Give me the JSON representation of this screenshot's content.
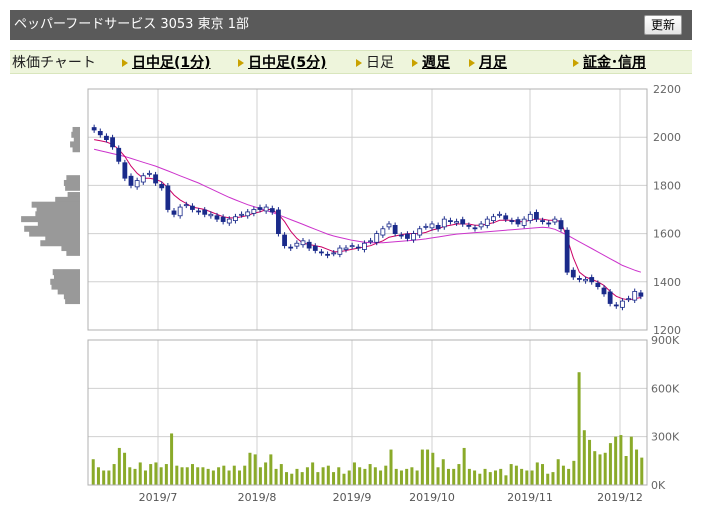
{
  "header": {
    "title": "ペッパーフードサービス 3053 東京 1部",
    "refresh_label": "更新"
  },
  "tabs": [
    {
      "label": "株価チャート",
      "style": "plain",
      "arrow": false
    },
    {
      "label": "日中足(1分)",
      "style": "link",
      "arrow": true
    },
    {
      "label": "日中足(5分)",
      "style": "link",
      "arrow": true
    },
    {
      "label": "日足",
      "style": "plain",
      "arrow": true
    },
    {
      "label": "週足",
      "style": "link",
      "arrow": true
    },
    {
      "label": "月足",
      "style": "link",
      "arrow": true
    },
    {
      "label": "証金･信用",
      "style": "link",
      "arrow": true
    }
  ],
  "colors": {
    "up_candle": "#ffffff",
    "down_candle": "#1a2a8a",
    "candle_outline": "#1a2a8a",
    "ma_short": "#cc0066",
    "ma_long": "#cc33cc",
    "volume": "#8aaa2a",
    "volume_profile": "#999999",
    "grid": "#d0d0d0"
  },
  "chart_data": [
    {
      "type": "candlestick",
      "ylim": [
        1200,
        2200
      ],
      "y_ticks": [
        "2200",
        "2000",
        "1800",
        "1600",
        "1400",
        "1200"
      ],
      "x_ticks": [
        "2019/7",
        "2019/8",
        "2019/9",
        "2019/10",
        "2019/11",
        "2019/12"
      ],
      "close": [
        2030,
        2010,
        1990,
        1960,
        1900,
        1830,
        1800,
        1820,
        1840,
        1850,
        1810,
        1790,
        1700,
        1680,
        1710,
        1720,
        1700,
        1690,
        1680,
        1680,
        1660,
        1650,
        1660,
        1670,
        1680,
        1690,
        1700,
        1700,
        1710,
        1690,
        1600,
        1550,
        1540,
        1560,
        1570,
        1540,
        1530,
        1520,
        1510,
        1520,
        1540,
        1540,
        1550,
        1540,
        1560,
        1570,
        1600,
        1620,
        1640,
        1600,
        1590,
        1580,
        1600,
        1620,
        1630,
        1640,
        1620,
        1660,
        1650,
        1650,
        1640,
        1630,
        1620,
        1640,
        1660,
        1670,
        1680,
        1660,
        1650,
        1640,
        1660,
        1680,
        1660,
        1650,
        1640,
        1660,
        1620,
        1440,
        1420,
        1410,
        1410,
        1400,
        1380,
        1350,
        1310,
        1300,
        1320,
        1330,
        1360,
        1340
      ],
      "ma_short": [
        1990,
        1985,
        1980,
        1970,
        1950,
        1920,
        1880,
        1850,
        1830,
        1830,
        1825,
        1815,
        1790,
        1760,
        1740,
        1725,
        1710,
        1705,
        1700,
        1690,
        1680,
        1670,
        1665,
        1665,
        1670,
        1675,
        1685,
        1690,
        1700,
        1700,
        1680,
        1650,
        1610,
        1580,
        1560,
        1555,
        1550,
        1545,
        1535,
        1525,
        1525,
        1530,
        1535,
        1540,
        1545,
        1550,
        1560,
        1570,
        1585,
        1590,
        1595,
        1600,
        1600,
        1600,
        1605,
        1615,
        1620,
        1630,
        1635,
        1640,
        1640,
        1640,
        1635,
        1635,
        1640,
        1645,
        1655,
        1655,
        1655,
        1650,
        1650,
        1655,
        1660,
        1660,
        1655,
        1655,
        1650,
        1580,
        1500,
        1440,
        1420,
        1410,
        1400,
        1385,
        1360,
        1340,
        1330,
        1325,
        1330,
        1335
      ],
      "ma_long": [
        1950,
        1944,
        1938,
        1932,
        1926,
        1920,
        1912,
        1904,
        1896,
        1888,
        1880,
        1870,
        1860,
        1850,
        1840,
        1830,
        1820,
        1810,
        1798,
        1786,
        1774,
        1762,
        1750,
        1740,
        1730,
        1720,
        1712,
        1704,
        1696,
        1688,
        1678,
        1668,
        1658,
        1648,
        1638,
        1628,
        1618,
        1608,
        1598,
        1590,
        1584,
        1578,
        1572,
        1568,
        1564,
        1562,
        1562,
        1562,
        1564,
        1566,
        1568,
        1570,
        1572,
        1575,
        1578,
        1582,
        1586,
        1590,
        1594,
        1598,
        1600,
        1602,
        1604,
        1606,
        1608,
        1610,
        1612,
        1614,
        1616,
        1618,
        1620,
        1622,
        1624,
        1626,
        1624,
        1618,
        1606,
        1594,
        1580,
        1566,
        1552,
        1538,
        1524,
        1510,
        1496,
        1482,
        1468,
        1458,
        1448,
        1440
      ],
      "volume_profile": [
        {
          "price": 2030,
          "value": 0.12
        },
        {
          "price": 2010,
          "value": 0.14
        },
        {
          "price": 1990,
          "value": 0.1
        },
        {
          "price": 1970,
          "value": 0.16
        },
        {
          "price": 1950,
          "value": 0.12
        },
        {
          "price": 1830,
          "value": 0.22
        },
        {
          "price": 1810,
          "value": 0.26
        },
        {
          "price": 1790,
          "value": 0.24
        },
        {
          "price": 1760,
          "value": 0.2
        },
        {
          "price": 1740,
          "value": 0.4
        },
        {
          "price": 1720,
          "value": 0.78
        },
        {
          "price": 1700,
          "value": 0.7
        },
        {
          "price": 1680,
          "value": 0.72
        },
        {
          "price": 1660,
          "value": 0.95
        },
        {
          "price": 1640,
          "value": 0.68
        },
        {
          "price": 1620,
          "value": 0.9
        },
        {
          "price": 1600,
          "value": 0.82
        },
        {
          "price": 1580,
          "value": 0.56
        },
        {
          "price": 1560,
          "value": 0.64
        },
        {
          "price": 1540,
          "value": 0.3
        },
        {
          "price": 1520,
          "value": 0.22
        },
        {
          "price": 1440,
          "value": 0.44
        },
        {
          "price": 1420,
          "value": 0.42
        },
        {
          "price": 1400,
          "value": 0.48
        },
        {
          "price": 1380,
          "value": 0.46
        },
        {
          "price": 1360,
          "value": 0.36
        },
        {
          "price": 1340,
          "value": 0.26
        },
        {
          "price": 1320,
          "value": 0.24
        }
      ]
    },
    {
      "type": "bar",
      "ylim": [
        0,
        900000
      ],
      "y_ticks": [
        "900K",
        "600K",
        "300K",
        "0K"
      ],
      "x_ticks": [
        "2019/7",
        "2019/8",
        "2019/9",
        "2019/10",
        "2019/11",
        "2019/12"
      ],
      "values": [
        160000,
        110000,
        90000,
        90000,
        130000,
        230000,
        200000,
        110000,
        100000,
        140000,
        90000,
        130000,
        140000,
        110000,
        130000,
        320000,
        120000,
        110000,
        110000,
        130000,
        110000,
        110000,
        100000,
        90000,
        110000,
        120000,
        90000,
        120000,
        90000,
        120000,
        200000,
        190000,
        110000,
        140000,
        190000,
        100000,
        130000,
        80000,
        70000,
        100000,
        80000,
        110000,
        140000,
        80000,
        110000,
        120000,
        80000,
        110000,
        70000,
        90000,
        140000,
        110000,
        100000,
        130000,
        110000,
        90000,
        120000,
        220000,
        100000,
        90000,
        100000,
        110000,
        90000,
        220000,
        220000,
        200000,
        110000,
        160000,
        100000,
        100000,
        130000,
        230000,
        100000,
        90000,
        70000,
        100000,
        80000,
        90000,
        100000,
        60000,
        130000,
        120000,
        100000,
        90000,
        90000,
        140000,
        130000,
        70000,
        80000,
        160000,
        120000,
        100000,
        150000,
        700000,
        340000,
        280000,
        210000,
        190000,
        200000,
        260000,
        300000,
        310000,
        180000,
        300000,
        220000,
        170000
      ]
    }
  ]
}
